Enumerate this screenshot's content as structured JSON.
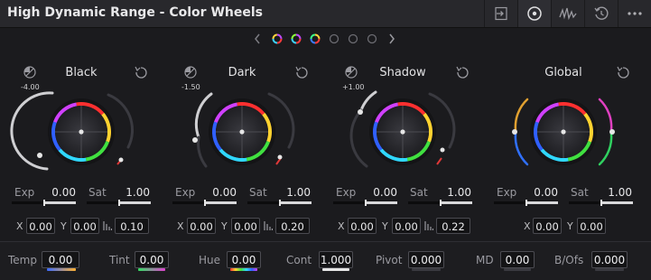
{
  "header": {
    "title": "High Dynamic Range - Color Wheels"
  },
  "wheels": [
    {
      "name": "Black",
      "zone_value": "-4.00",
      "exp": "0.00",
      "sat": "1.00",
      "x": "0.00",
      "y": "0.00",
      "falloff": "0.10"
    },
    {
      "name": "Dark",
      "zone_value": "-1.50",
      "exp": "0.00",
      "sat": "1.00",
      "x": "0.00",
      "y": "0.00",
      "falloff": "0.20"
    },
    {
      "name": "Shadow",
      "zone_value": "+1.00",
      "exp": "0.00",
      "sat": "1.00",
      "x": "0.00",
      "y": "0.00",
      "falloff": "0.22"
    },
    {
      "name": "Global",
      "zone_value": "",
      "exp": "0.00",
      "sat": "1.00",
      "x": "0.00",
      "y": "0.00",
      "falloff": ""
    }
  ],
  "labels": {
    "exp": "Exp",
    "sat": "Sat",
    "x": "X",
    "y": "Y"
  },
  "bottom": {
    "temp_label": "Temp",
    "temp": "0.00",
    "tint_label": "Tint",
    "tint": "0.00",
    "hue_label": "Hue",
    "hue": "0.00",
    "cont_label": "Cont",
    "cont": "1.000",
    "pivot_label": "Pivot",
    "pivot": "0.000",
    "md_label": "MD",
    "md": "0.00",
    "bofs_label": "B/Ofs",
    "bofs": "0.000"
  },
  "pager": {
    "color_pages": 3,
    "empty_pages": 3
  }
}
